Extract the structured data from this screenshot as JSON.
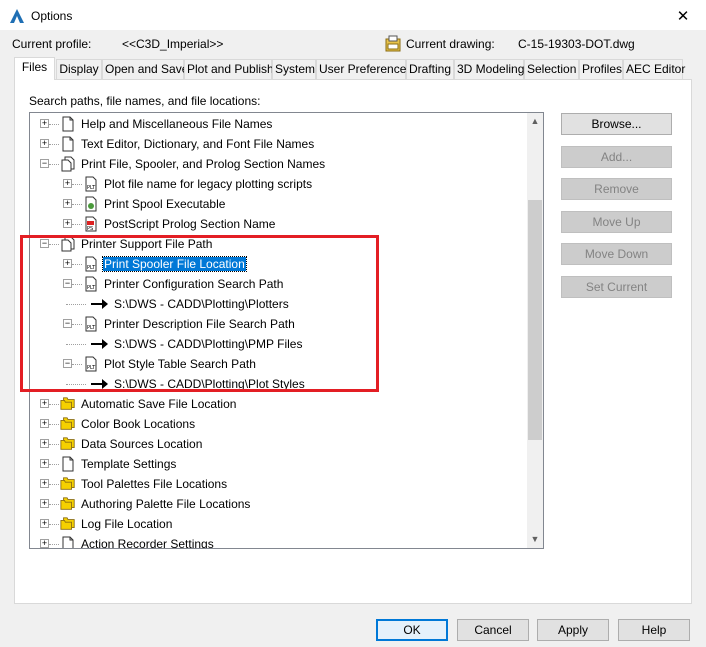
{
  "window": {
    "title": "Options",
    "close_glyph": "✕"
  },
  "profile": {
    "current_profile_label": "Current profile:",
    "current_profile_value": "<<C3D_Imperial>>",
    "current_drawing_label": "Current drawing:",
    "current_drawing_value": "C-15-19303-DOT.dwg"
  },
  "tabs": [
    {
      "label": "Files",
      "active": true
    },
    {
      "label": "Display"
    },
    {
      "label": "Open and Save"
    },
    {
      "label": "Plot and Publish"
    },
    {
      "label": "System"
    },
    {
      "label": "User Preferences"
    },
    {
      "label": "Drafting"
    },
    {
      "label": "3D Modeling"
    },
    {
      "label": "Selection"
    },
    {
      "label": "Profiles"
    },
    {
      "label": "AEC Editor"
    }
  ],
  "files_panel": {
    "label": "Search paths, file names, and file locations:"
  },
  "tree": [
    {
      "label": "Help and Miscellaneous File Names",
      "level": 0,
      "exp": "+",
      "icon": "document-icon"
    },
    {
      "label": "Text Editor, Dictionary, and Font File Names",
      "level": 0,
      "exp": "+",
      "icon": "document-icon"
    },
    {
      "label": "Print File, Spooler, and Prolog Section Names",
      "level": 0,
      "exp": "-",
      "icon": "documents-icon"
    },
    {
      "label": "Plot file name for legacy plotting scripts",
      "level": 1,
      "exp": "+",
      "icon": "plt-icon"
    },
    {
      "label": "Print Spool Executable",
      "level": 1,
      "exp": "+",
      "icon": "exe-icon"
    },
    {
      "label": "PostScript Prolog Section Name",
      "level": 1,
      "exp": "+",
      "icon": "ps-icon"
    },
    {
      "label": "Printer Support File Path",
      "level": 0,
      "exp": "-",
      "icon": "documents-icon"
    },
    {
      "label": "Print Spooler File Location",
      "level": 1,
      "exp": "+",
      "icon": "plt-icon",
      "selected": true
    },
    {
      "label": "Printer Configuration Search Path",
      "level": 1,
      "exp": "-",
      "icon": "plt-icon"
    },
    {
      "label": "S:\\DWS - CADD\\Plotting\\Plotters",
      "level": 2,
      "icon": "arrow-icon"
    },
    {
      "label": "Printer Description File Search Path",
      "level": 1,
      "exp": "-",
      "icon": "plt-icon"
    },
    {
      "label": "S:\\DWS - CADD\\Plotting\\PMP Files",
      "level": 2,
      "icon": "arrow-icon"
    },
    {
      "label": "Plot Style Table Search Path",
      "level": 1,
      "exp": "-",
      "icon": "plt-icon"
    },
    {
      "label": "S:\\DWS - CADD\\Plotting\\Plot Styles",
      "level": 2,
      "icon": "arrow-icon"
    },
    {
      "label": "Automatic Save File Location",
      "level": 0,
      "exp": "+",
      "icon": "folders-icon"
    },
    {
      "label": "Color Book Locations",
      "level": 0,
      "exp": "+",
      "icon": "folders-icon"
    },
    {
      "label": "Data Sources Location",
      "level": 0,
      "exp": "+",
      "icon": "folders-icon"
    },
    {
      "label": "Template Settings",
      "level": 0,
      "exp": "+",
      "icon": "document-icon"
    },
    {
      "label": "Tool Palettes File Locations",
      "level": 0,
      "exp": "+",
      "icon": "folders-icon"
    },
    {
      "label": "Authoring Palette File Locations",
      "level": 0,
      "exp": "+",
      "icon": "folders-icon"
    },
    {
      "label": "Log File Location",
      "level": 0,
      "exp": "+",
      "icon": "folders-icon"
    },
    {
      "label": "Action Recorder Settings",
      "level": 0,
      "exp": "+",
      "icon": "document-icon"
    }
  ],
  "side_buttons": {
    "browse": "Browse...",
    "add": "Add...",
    "remove": "Remove",
    "move_up": "Move Up",
    "move_down": "Move Down",
    "set_current": "Set Current"
  },
  "bottom_buttons": {
    "ok": "OK",
    "cancel": "Cancel",
    "apply": "Apply",
    "help": "Help"
  },
  "colors": {
    "selection": "#0078d7",
    "annotation_box": "#e31e24",
    "folder_yellow": "#f5d000"
  }
}
